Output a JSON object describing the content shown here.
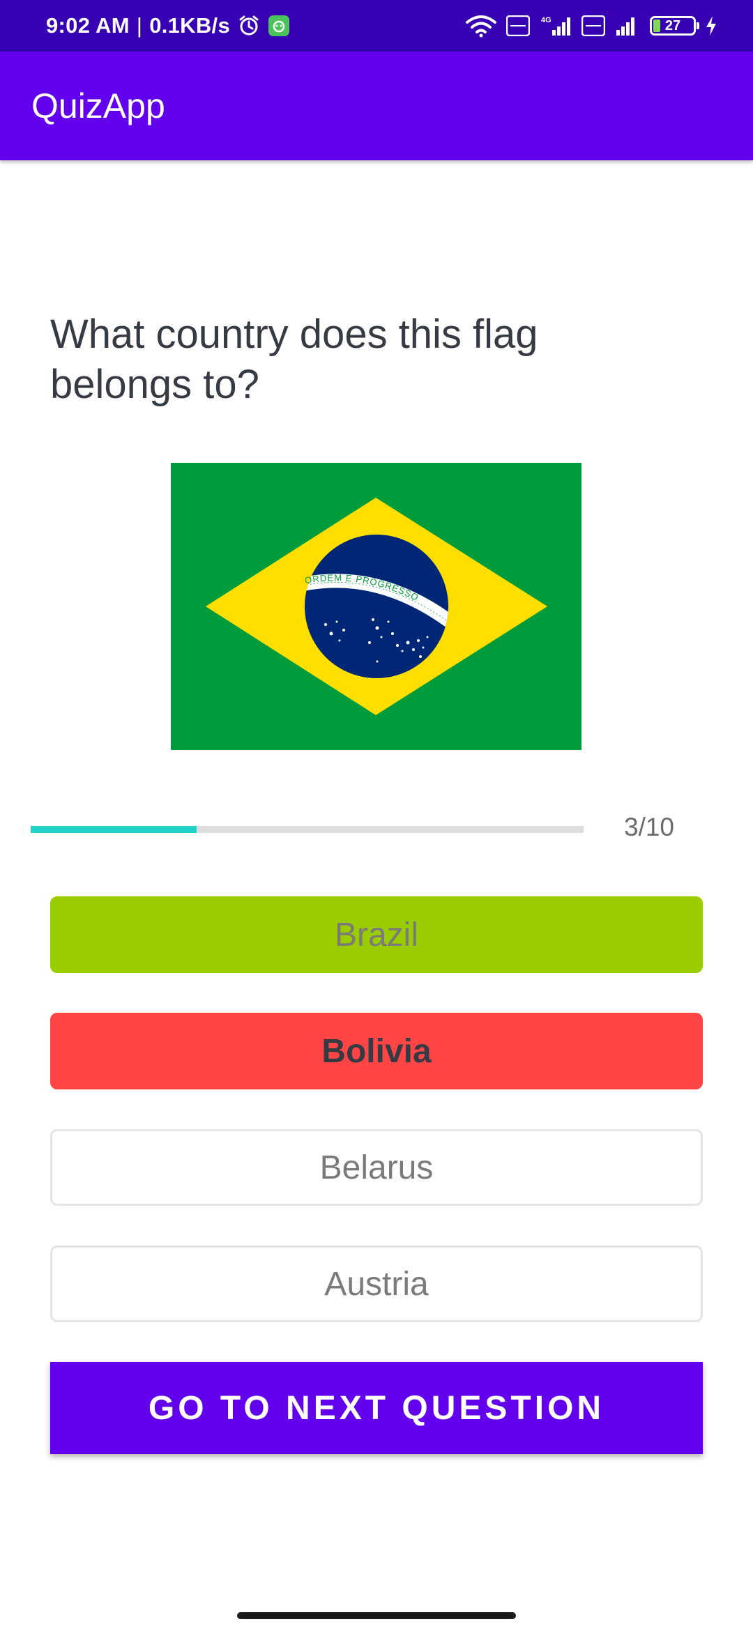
{
  "status_bar": {
    "time": "9:02 AM",
    "separator": "|",
    "network_speed": "0.1KB/s",
    "battery_level": "27",
    "network_type": "4G",
    "icons": [
      "alarm-icon",
      "notification-app-icon",
      "wifi-icon",
      "volte-icon",
      "signal-icon",
      "battery-icon",
      "charging-icon"
    ]
  },
  "app_bar": {
    "title": "QuizApp"
  },
  "question": {
    "text": "What country does this flag belongs to?"
  },
  "flag": {
    "image": "flag-brazil",
    "motto": "ORDEM E PROGRESSO",
    "colors": {
      "green": "#009b3a",
      "yellow": "#fedf00",
      "blue": "#002776"
    }
  },
  "progress": {
    "current": 3,
    "total": 10,
    "fraction": 0.3,
    "label": "3/10"
  },
  "options": [
    {
      "label": "Brazil",
      "state": "correct"
    },
    {
      "label": "Bolivia",
      "state": "wrong-selected"
    },
    {
      "label": "Belarus",
      "state": "default"
    },
    {
      "label": "Austria",
      "state": "default"
    }
  ],
  "next_button": {
    "label": "GO TO NEXT QUESTION"
  },
  "colors": {
    "primary": "#6200ee",
    "primary_dark": "#3700b3",
    "correct": "#9acd00",
    "wrong": "#ff4545",
    "progress": "#1fd1c7"
  }
}
